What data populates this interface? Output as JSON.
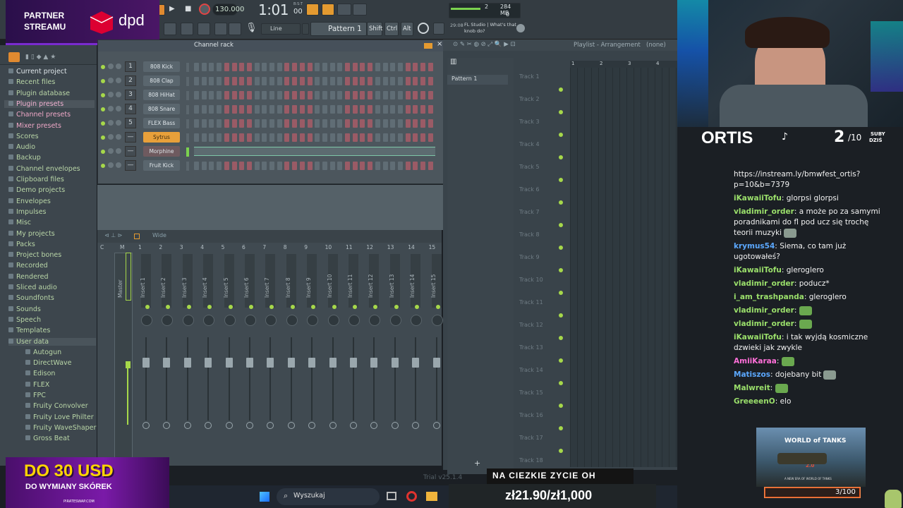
{
  "sponsor": {
    "line1": "PARTNER",
    "line2": "STREAMU",
    "brand": "dpd",
    "brand_color": "#dc0032"
  },
  "toolbar": {
    "tempo": "130.000",
    "time": "1:01",
    "time_small": "00",
    "time_unit": "B:S:T",
    "snap": "Line",
    "pattern": "Pattern 1",
    "mod_shift": "Shift",
    "mod_ctrl": "Ctrl",
    "mod_alt": "Alt",
    "cpu_val": "2",
    "mem_val": "284 MB",
    "poly": "0",
    "hint_time": "29:08",
    "hint_text": "FL Studio | What's that knob do?"
  },
  "browser": {
    "items": [
      {
        "label": "Current project"
      },
      {
        "label": "Recent files"
      },
      {
        "label": "Plugin database"
      },
      {
        "label": "Plugin presets"
      },
      {
        "label": "Channel presets"
      },
      {
        "label": "Mixer presets"
      },
      {
        "label": "Scores"
      },
      {
        "label": "Audio"
      },
      {
        "label": "Backup"
      },
      {
        "label": "Channel envelopes"
      },
      {
        "label": "Clipboard files"
      },
      {
        "label": "Demo projects"
      },
      {
        "label": "Envelopes"
      },
      {
        "label": "Impulses"
      },
      {
        "label": "Misc"
      },
      {
        "label": "My projects"
      },
      {
        "label": "Packs"
      },
      {
        "label": "Project bones"
      },
      {
        "label": "Recorded"
      },
      {
        "label": "Rendered"
      },
      {
        "label": "Sliced audio"
      },
      {
        "label": "Soundfonts"
      },
      {
        "label": "Sounds"
      },
      {
        "label": "Speech"
      },
      {
        "label": "Templates"
      },
      {
        "label": "User data"
      }
    ],
    "sub": [
      {
        "label": "Autogun"
      },
      {
        "label": "DirectWave"
      },
      {
        "label": "Edison"
      },
      {
        "label": "FLEX"
      },
      {
        "label": "FPC"
      },
      {
        "label": "Fruity Convolver"
      },
      {
        "label": "Fruity Love Philter"
      },
      {
        "label": "Fruity WaveShaper"
      },
      {
        "label": "Gross Beat"
      }
    ]
  },
  "rack": {
    "title": "Channel rack",
    "channels": [
      {
        "num": "1",
        "name": "808 Kick"
      },
      {
        "num": "2",
        "name": "808 Clap"
      },
      {
        "num": "3",
        "name": "808 HiHat"
      },
      {
        "num": "4",
        "name": "808 Snare"
      },
      {
        "num": "5",
        "name": "FLEX Bass"
      },
      {
        "num": "",
        "name": "Sytrus"
      },
      {
        "num": "",
        "name": "Morphine"
      },
      {
        "num": "",
        "name": "Fruit Kick"
      }
    ],
    "add": "+"
  },
  "mixer": {
    "mode": "Wide",
    "master": "Master",
    "inserts": [
      "Insert 1",
      "Insert 2",
      "Insert 3",
      "Insert 4",
      "Insert 5",
      "Insert 6",
      "Insert 7",
      "Insert 8",
      "Insert 9",
      "Insert 10",
      "Insert 11",
      "Insert 12",
      "Insert 13",
      "Insert 14",
      "Insert 15"
    ],
    "col_nums": [
      "C",
      "M",
      "1",
      "2",
      "3",
      "4",
      "5",
      "6",
      "7",
      "8",
      "9",
      "10",
      "11",
      "12",
      "13",
      "14",
      "15"
    ]
  },
  "playlist": {
    "title": "Playlist - Arrangement",
    "sel": "(none)",
    "pattern": "Pattern 1",
    "bars": [
      "1",
      "2",
      "3",
      "4"
    ],
    "tracks": [
      "Track 1",
      "Track 2",
      "Track 3",
      "Track 4",
      "Track 5",
      "Track 6",
      "Track 7",
      "Track 8",
      "Track 9",
      "Track 10",
      "Track 11",
      "Track 12",
      "Track 13",
      "Track 14",
      "Track 15",
      "Track 16",
      "Track 17",
      "Track 18"
    ],
    "version": "Trial v25.1.4"
  },
  "streamer": {
    "name": "ORTIS",
    "subs_current": "2",
    "subs_goal": "/10",
    "subs_label1": "SUBY",
    "subs_label2": "DZIŚ"
  },
  "chat": [
    {
      "user": "",
      "msg": "https://instream.ly/bmwfest_ortis?p=10&b=7379",
      "color": "#ffffff"
    },
    {
      "user": "iKawaiiTofu",
      "msg": "glorpsi glorpsi",
      "color": "#9be06b"
    },
    {
      "user": "vladimir_order",
      "msg": "a może po za samymi poradnikami do fl pod ucz się trochę teorii muzyki",
      "color": "#9be06b"
    },
    {
      "user": "krymus54",
      "msg": "Siema, co tam już ugotowałeś?",
      "color": "#5ba8ff"
    },
    {
      "user": "iKawaiiTofu",
      "msg": "gleroglero",
      "color": "#9be06b"
    },
    {
      "user": "vladimir_order",
      "msg": "poducz*",
      "color": "#9be06b"
    },
    {
      "user": "i_am_trashpanda",
      "msg": "gleroglero",
      "color": "#9be06b"
    },
    {
      "user": "vladimir_order",
      "msg": "",
      "color": "#9be06b"
    },
    {
      "user": "vladimir_order",
      "msg": "",
      "color": "#9be06b"
    },
    {
      "user": "iKawaiiTofu",
      "msg": "i tak wyjdą kosmiczne dzwieki jak zwykle",
      "color": "#9be06b"
    },
    {
      "user": "AmiiKaraa",
      "msg": "",
      "color": "#ff6fd8"
    },
    {
      "user": "Matiszos",
      "msg": "dojebany bit",
      "color": "#5ba8ff"
    },
    {
      "user": "Malwreit",
      "msg": "",
      "color": "#9be06b"
    },
    {
      "user": "GreeeenO",
      "msg": "elo",
      "color": "#9be06b"
    }
  ],
  "ad_wot": {
    "title": "WORLD of TANKS",
    "sub": "A NEW ERA OF WORLD OF TANKS",
    "ver": "2.0",
    "progress": "3/100"
  },
  "ad_skins": {
    "line1": "DO 30 USD",
    "line2": "DO WYMIANY SKÓREK",
    "site": "PIRATESWAP.COM"
  },
  "taskbar": {
    "search": "Wyszukaj"
  },
  "ticker": {
    "top": "NA CIEZKIE ZYCIE OH",
    "bottom": "zł21.90/zł1,000"
  }
}
